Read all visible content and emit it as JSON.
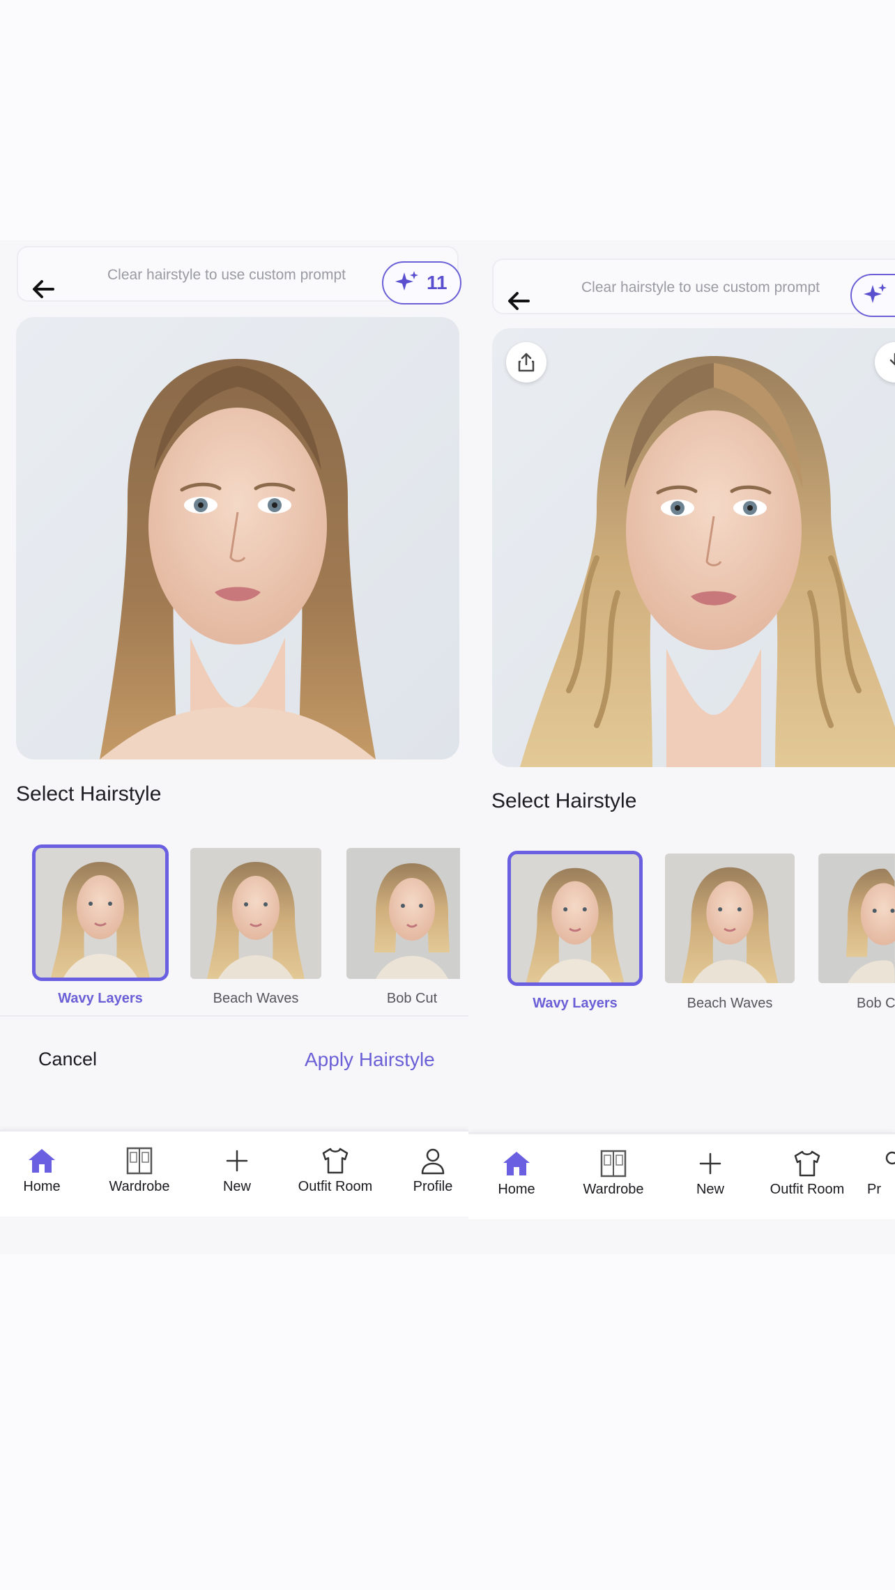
{
  "left_screen": {
    "prompt_placeholder": "Clear hairstyle to use custom prompt",
    "credits": "11",
    "section_title": "Select Hairstyle",
    "hairstyles": [
      {
        "label": "Wavy Layers",
        "selected": true
      },
      {
        "label": "Beach Waves",
        "selected": false
      },
      {
        "label": "Bob Cut",
        "selected": false
      }
    ],
    "cancel_label": "Cancel",
    "apply_label": "Apply Hairstyle",
    "tabs": [
      "Home",
      "Wardrobe",
      "New",
      "Outfit Room",
      "Profile"
    ]
  },
  "right_screen": {
    "prompt_placeholder": "Clear hairstyle to use custom prompt",
    "section_title": "Select Hairstyle",
    "hairstyles": [
      {
        "label": "Wavy Layers",
        "selected": true
      },
      {
        "label": "Beach Waves",
        "selected": false
      },
      {
        "label": "Bob C",
        "selected": false
      }
    ],
    "tabs": [
      "Home",
      "Wardrobe",
      "New",
      "Outfit Room",
      "Pr"
    ]
  },
  "colors": {
    "accent": "#6a5fd6",
    "background": "#f7f7f9",
    "text": "#1b1b1f",
    "muted_text": "#9a9aa3"
  },
  "icons": [
    "back-arrow-icon",
    "sparkles-icon",
    "share-icon",
    "home-icon",
    "wardrobe-icon",
    "plus-icon",
    "tshirt-icon",
    "profile-icon"
  ]
}
